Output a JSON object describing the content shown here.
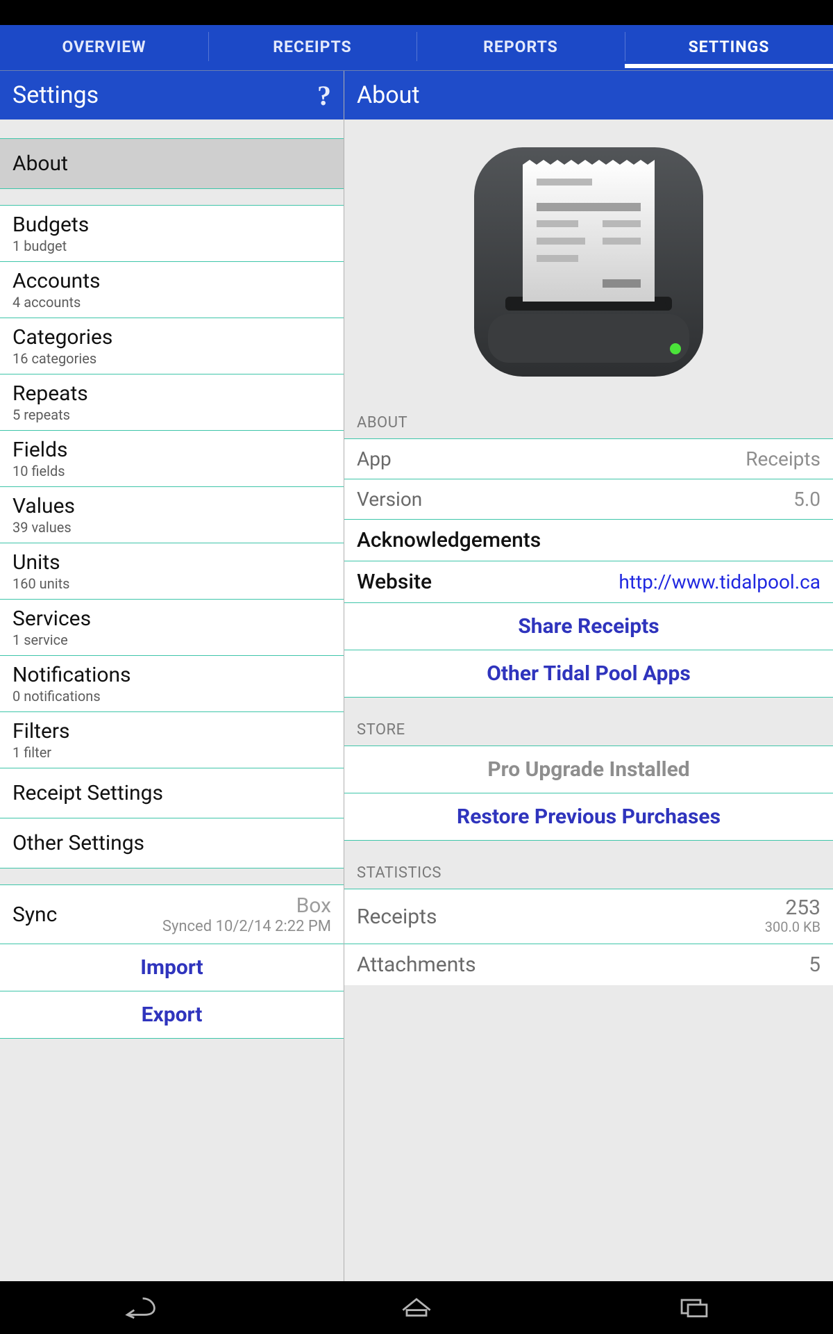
{
  "tabs": [
    "OVERVIEW",
    "RECEIPTS",
    "REPORTS",
    "SETTINGS"
  ],
  "activeTab": 3,
  "left": {
    "title": "Settings",
    "helpGlyph": "?",
    "aboutItem": "About",
    "items": [
      {
        "title": "Budgets",
        "sub": "1 budget"
      },
      {
        "title": "Accounts",
        "sub": "4 accounts"
      },
      {
        "title": "Categories",
        "sub": "16 categories"
      },
      {
        "title": "Repeats",
        "sub": "5 repeats"
      },
      {
        "title": "Fields",
        "sub": "10 fields"
      },
      {
        "title": "Values",
        "sub": "39 values"
      },
      {
        "title": "Units",
        "sub": "160 units"
      },
      {
        "title": "Services",
        "sub": "1 service"
      },
      {
        "title": "Notifications",
        "sub": "0 notifications"
      },
      {
        "title": "Filters",
        "sub": "1 filter"
      }
    ],
    "receiptSettings": "Receipt Settings",
    "otherSettings": "Other Settings",
    "sync": {
      "label": "Sync",
      "service": "Box",
      "status": "Synced 10/2/14 2:22 PM"
    },
    "import": "Import",
    "export": "Export"
  },
  "right": {
    "title": "About",
    "sections": {
      "aboutLabel": "ABOUT",
      "storeLabel": "STORE",
      "statsLabel": "STATISTICS"
    },
    "about": {
      "appLabel": "App",
      "appValue": "Receipts",
      "versionLabel": "Version",
      "versionValue": "5.0",
      "ack": "Acknowledgements",
      "websiteLabel": "Website",
      "websiteValue": "http://www.tidalpool.ca",
      "share": "Share Receipts",
      "otherApps": "Other Tidal Pool Apps"
    },
    "store": {
      "pro": "Pro Upgrade Installed",
      "restore": "Restore Previous Purchases"
    },
    "stats": {
      "receiptsLabel": "Receipts",
      "receiptsCount": "253",
      "receiptsSize": "300.0 KB",
      "attachmentsLabel": "Attachments",
      "attachmentsCount": "5"
    }
  }
}
